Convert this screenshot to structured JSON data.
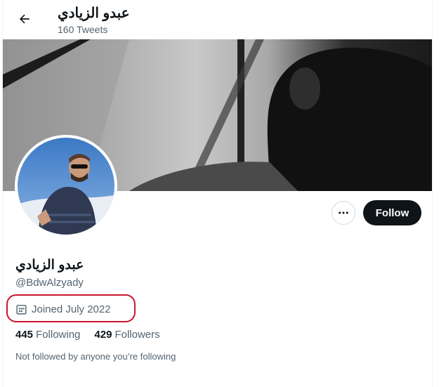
{
  "header": {
    "back_icon": "arrow-left-icon",
    "title": "عبدو الزيادي",
    "tweets_count": "160",
    "tweets_label": "Tweets"
  },
  "profile": {
    "display_name": "عبدو الزيادي",
    "handle": "@BdwAlzyady",
    "joined_icon": "calendar-icon",
    "joined": "Joined July 2022",
    "following_count": "445",
    "following_label": "Following",
    "followers_count": "429",
    "followers_label": "Followers",
    "mutuals_note": "Not followed by anyone you’re following"
  },
  "actions": {
    "more_icon": "more-dots-icon",
    "follow_label": "Follow"
  },
  "colors": {
    "follow_bg": "#0f1419",
    "muted_text": "#536471",
    "highlight_ring": "#c8172b"
  }
}
